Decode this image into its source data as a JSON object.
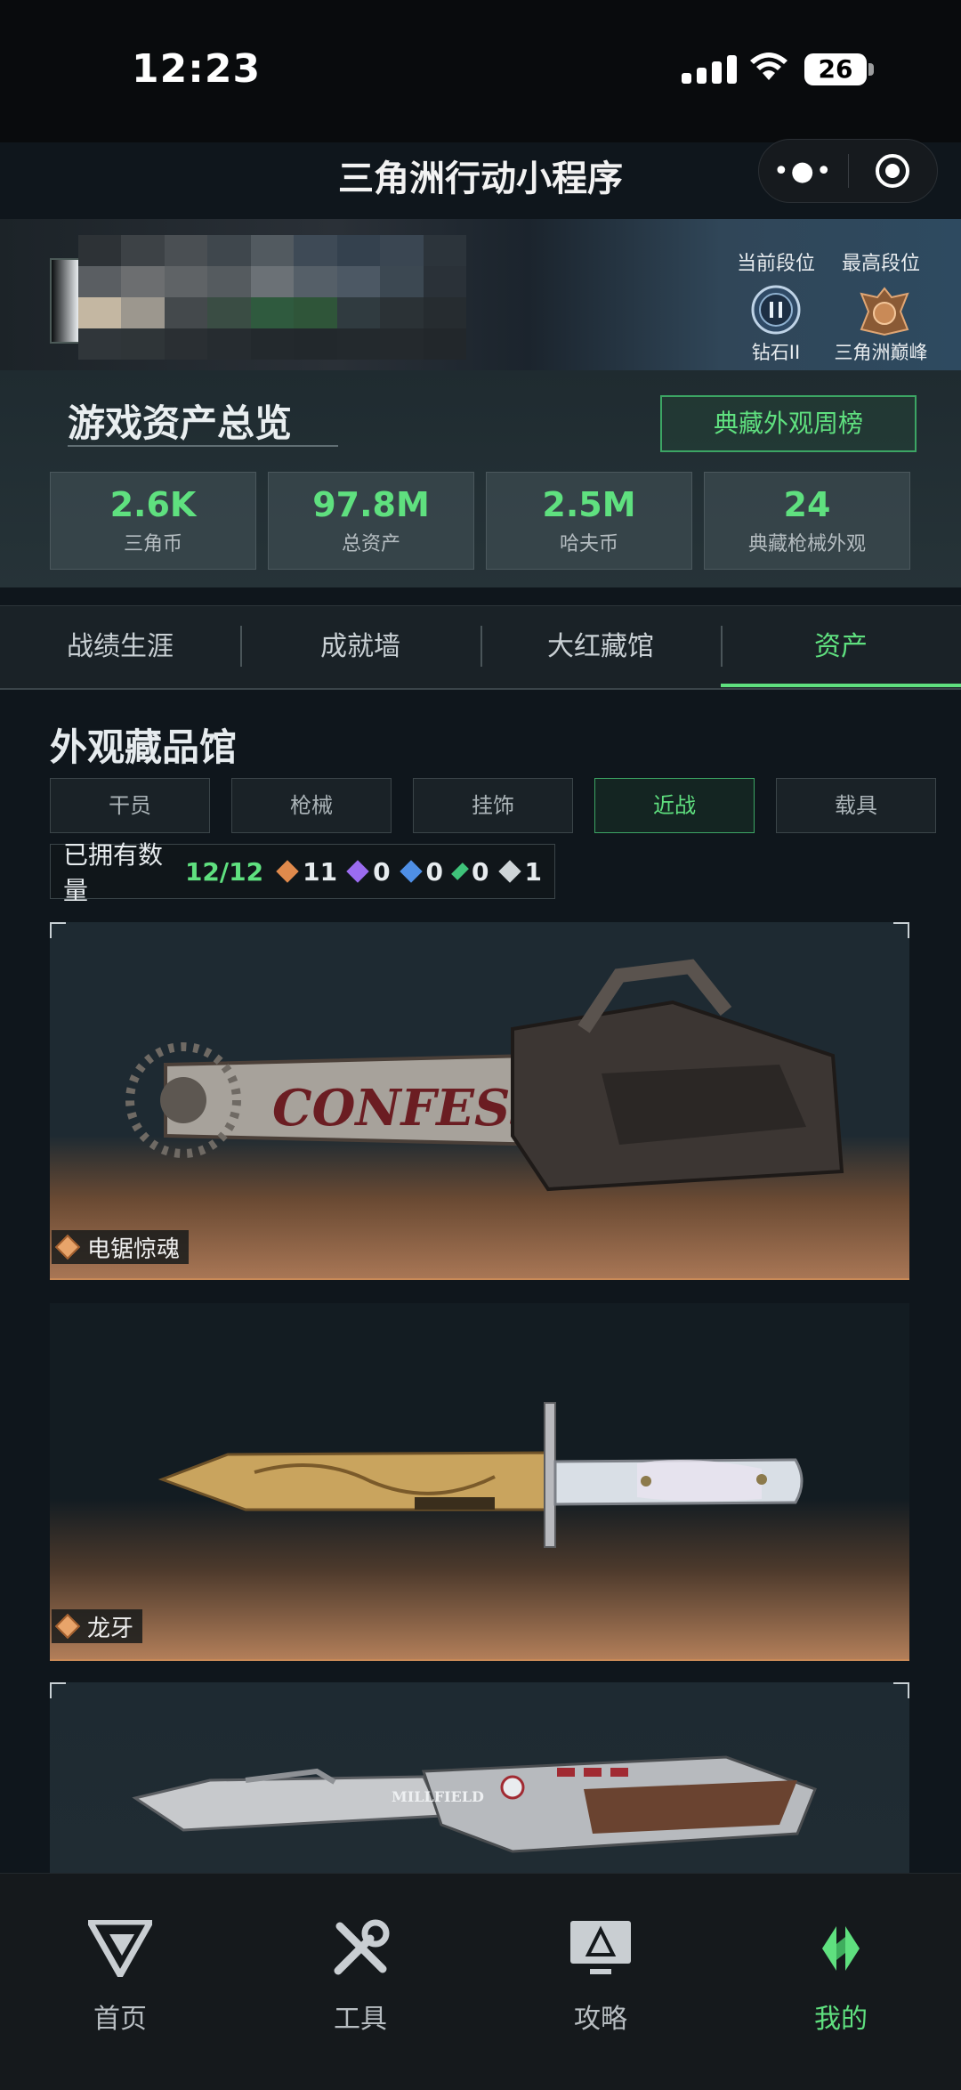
{
  "status_bar": {
    "time": "12:23",
    "battery": "26"
  },
  "app": {
    "title": "三角洲行动小程序"
  },
  "profile": {
    "current_rank_label": "当前段位",
    "current_rank": "钻石II",
    "highest_rank_label": "最高段位",
    "highest_rank": "三角洲巅峰"
  },
  "overview": {
    "title": "游戏资产总览",
    "weekly_button": "典藏外观周榜",
    "stats": [
      {
        "value": "2.6K",
        "label": "三角币"
      },
      {
        "value": "97.8M",
        "label": "总资产"
      },
      {
        "value": "2.5M",
        "label": "哈夫币"
      },
      {
        "value": "24",
        "label": "典藏枪械外观"
      }
    ]
  },
  "tabs": [
    {
      "label": "战绩生涯"
    },
    {
      "label": "成就墙"
    },
    {
      "label": "大红藏馆"
    },
    {
      "label": "资产"
    }
  ],
  "collection": {
    "title": "外观藏品馆",
    "categories": [
      {
        "label": "干员"
      },
      {
        "label": "枪械"
      },
      {
        "label": "挂饰"
      },
      {
        "label": "近战"
      },
      {
        "label": "载具"
      }
    ],
    "owned_label": "已拥有数量",
    "owned_count": "12/12",
    "rarities": [
      {
        "color": "#e08a4c",
        "count": "11"
      },
      {
        "color": "#9b6cf0",
        "count": "0"
      },
      {
        "color": "#4f8fe6",
        "count": "0"
      },
      {
        "color": "#3fc37a",
        "count": "0"
      },
      {
        "color": "#cfd5d8",
        "count": "1"
      }
    ],
    "items": [
      {
        "name": "电锯惊魂"
      },
      {
        "name": "龙牙"
      },
      {
        "name": ""
      }
    ]
  },
  "bottom_nav": [
    {
      "label": "首页",
      "icon": "home-logo-icon"
    },
    {
      "label": "工具",
      "icon": "tools-icon"
    },
    {
      "label": "攻略",
      "icon": "guide-monitor-icon"
    },
    {
      "label": "我的",
      "icon": "profile-logo-icon"
    }
  ],
  "colors": {
    "accent": "#5fe07f",
    "background": "#0f161c"
  }
}
